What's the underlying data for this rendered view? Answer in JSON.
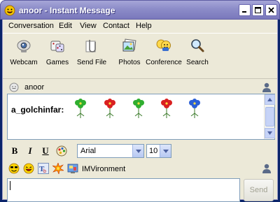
{
  "window": {
    "title": "anoor - Instant Message",
    "accent_color": "#8c8cc8"
  },
  "menu": {
    "items": [
      {
        "label": "Conversation"
      },
      {
        "label": "Edit"
      },
      {
        "label": "View"
      },
      {
        "label": "Contact"
      },
      {
        "label": "Help"
      }
    ]
  },
  "toolbar": {
    "items": [
      {
        "label": "Webcam",
        "icon": "webcam-icon"
      },
      {
        "label": "Games",
        "icon": "dice-icon"
      },
      {
        "label": "Send File",
        "icon": "paperclip-icon"
      },
      {
        "label": "Photos",
        "icon": "photos-icon"
      },
      {
        "label": "Conference",
        "icon": "conference-icon"
      },
      {
        "label": "Search",
        "icon": "magnifier-icon"
      }
    ]
  },
  "recipient": {
    "name": "anoor"
  },
  "history": {
    "sender": "a_golchinfar:",
    "flower_colors": [
      "#2fae2f",
      "#d92020",
      "#2fae2f",
      "#d92020",
      "#2a5fd6"
    ]
  },
  "format": {
    "bold": "B",
    "italic": "I",
    "underline": "U",
    "font": "Arial",
    "size": "10"
  },
  "emote_bar": {
    "imvironment_label": "IMVironment"
  },
  "compose": {
    "value": "",
    "send_label": "Send"
  }
}
